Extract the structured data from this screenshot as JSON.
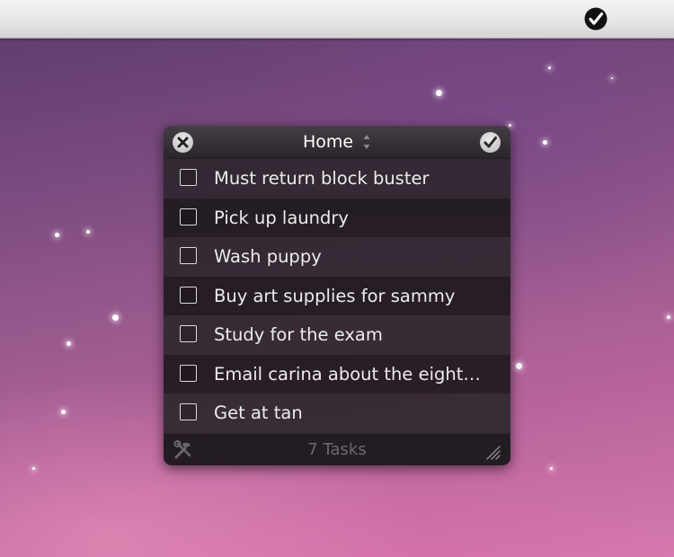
{
  "menubar": {
    "status_icon": "checkmark-circle-icon"
  },
  "panel": {
    "title": "Home",
    "close_icon": "close-icon",
    "list_selector_icon": "up-down-arrows-icon",
    "done_icon": "checkmark-icon"
  },
  "tasks": [
    {
      "label": "Must return block buster",
      "done": false
    },
    {
      "label": "Pick up laundry",
      "done": false
    },
    {
      "label": "Wash puppy",
      "done": false
    },
    {
      "label": "Buy art supplies for sammy",
      "done": false
    },
    {
      "label": "Study for the exam",
      "done": false
    },
    {
      "label": "Email carina about the eight…",
      "done": false
    },
    {
      "label": "Get at tan",
      "done": false
    }
  ],
  "footer": {
    "count_label": "7 Tasks",
    "tools_icon": "hammer-wrench-icon",
    "resize_icon": "resize-grip-icon"
  }
}
